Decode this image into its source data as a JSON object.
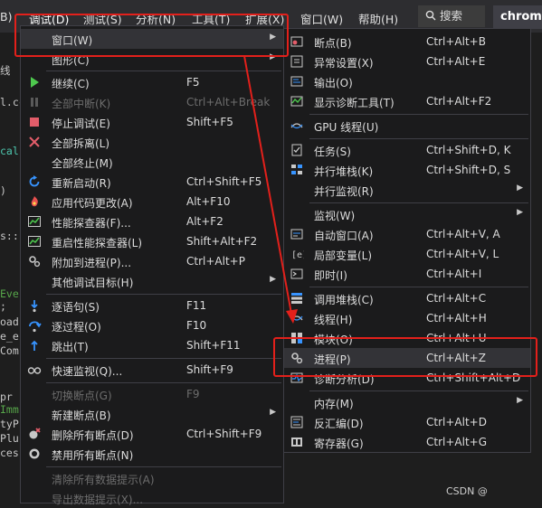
{
  "menubar": {
    "items": [
      "B)",
      "调试(D)",
      "测试(S)",
      "分析(N)",
      "工具(T)",
      "扩展(X)",
      "窗口(W)",
      "帮助(H)"
    ],
    "search_label": "搜索",
    "tab_label": "chrome"
  },
  "code_fragments": [
    "线",
    "l.cc",
    "cal",
    ")",
    "s::",
    "Eve",
    ";",
    "oad",
    "e_e",
    "Com",
    "pr",
    "Imm",
    "tyP",
    "Plu",
    "ces"
  ],
  "debug_menu": {
    "items": [
      {
        "label": "窗口(W)",
        "shortcut": "",
        "submenu": true,
        "icon": "none",
        "disabled": false
      },
      {
        "label": "图形(C)",
        "shortcut": "",
        "submenu": true,
        "icon": "none",
        "disabled": false
      },
      {
        "label": "继续(C)",
        "shortcut": "F5",
        "submenu": false,
        "icon": "play-icon",
        "disabled": false
      },
      {
        "label": "全部中断(K)",
        "shortcut": "Ctrl+Alt+Break",
        "submenu": false,
        "icon": "pause-icon",
        "disabled": true
      },
      {
        "label": "停止调试(E)",
        "shortcut": "Shift+F5",
        "submenu": false,
        "icon": "stop-icon",
        "disabled": false
      },
      {
        "label": "全部拆离(L)",
        "shortcut": "",
        "submenu": false,
        "icon": "detach-icon",
        "disabled": false
      },
      {
        "label": "全部终止(M)",
        "shortcut": "",
        "submenu": false,
        "icon": "none",
        "disabled": false
      },
      {
        "label": "重新启动(R)",
        "shortcut": "Ctrl+Shift+F5",
        "submenu": false,
        "icon": "restart-icon",
        "disabled": false
      },
      {
        "label": "应用代码更改(A)",
        "shortcut": "Alt+F10",
        "submenu": false,
        "icon": "hot-reload-icon",
        "disabled": false
      },
      {
        "label": "性能探查器(F)...",
        "shortcut": "Alt+F2",
        "submenu": false,
        "icon": "profiler-icon",
        "disabled": false
      },
      {
        "label": "重启性能探查器(L)",
        "shortcut": "Shift+Alt+F2",
        "submenu": false,
        "icon": "profiler-restart-icon",
        "disabled": false
      },
      {
        "label": "附加到进程(P)...",
        "shortcut": "Ctrl+Alt+P",
        "submenu": false,
        "icon": "attach-gear-icon",
        "disabled": false
      },
      {
        "label": "其他调试目标(H)",
        "shortcut": "",
        "submenu": true,
        "icon": "none",
        "disabled": false
      },
      {
        "label": "逐语句(S)",
        "shortcut": "F11",
        "submenu": false,
        "icon": "step-into-icon",
        "disabled": false
      },
      {
        "label": "逐过程(O)",
        "shortcut": "F10",
        "submenu": false,
        "icon": "step-over-icon",
        "disabled": false
      },
      {
        "label": "跳出(T)",
        "shortcut": "Shift+F11",
        "submenu": false,
        "icon": "step-out-icon",
        "disabled": false
      },
      {
        "label": "快速监视(Q)...",
        "shortcut": "Shift+F9",
        "submenu": false,
        "icon": "glasses-icon",
        "disabled": false
      },
      {
        "label": "切换断点(G)",
        "shortcut": "F9",
        "submenu": false,
        "icon": "none",
        "disabled": true
      },
      {
        "label": "新建断点(B)",
        "shortcut": "",
        "submenu": true,
        "icon": "none",
        "disabled": false
      },
      {
        "label": "删除所有断点(D)",
        "shortcut": "Ctrl+Shift+F9",
        "submenu": false,
        "icon": "delete-breakpoints-icon",
        "disabled": false
      },
      {
        "label": "禁用所有断点(N)",
        "shortcut": "",
        "submenu": false,
        "icon": "disable-breakpoints-icon",
        "disabled": false
      },
      {
        "label": "清除所有数据提示(A)",
        "shortcut": "",
        "submenu": false,
        "icon": "none",
        "disabled": true
      },
      {
        "label": "导出数据提示(X)...",
        "shortcut": "",
        "submenu": false,
        "icon": "none",
        "disabled": true
      }
    ]
  },
  "window_submenu": {
    "items": [
      {
        "label": "断点(B)",
        "shortcut": "Ctrl+Alt+B",
        "submenu": false,
        "icon": "breakpoints-window-icon"
      },
      {
        "label": "异常设置(X)",
        "shortcut": "Ctrl+Alt+E",
        "submenu": false,
        "icon": "exception-settings-icon"
      },
      {
        "label": "输出(O)",
        "shortcut": "",
        "submenu": false,
        "icon": "output-icon"
      },
      {
        "label": "显示诊断工具(T)",
        "shortcut": "Ctrl+Alt+F2",
        "submenu": false,
        "icon": "diagnostic-tools-icon"
      },
      {
        "label": "GPU 线程(U)",
        "shortcut": "",
        "submenu": false,
        "icon": "gpu-threads-icon"
      },
      {
        "label": "任务(S)",
        "shortcut": "Ctrl+Shift+D, K",
        "submenu": false,
        "icon": "tasks-icon"
      },
      {
        "label": "并行堆栈(K)",
        "shortcut": "Ctrl+Shift+D, S",
        "submenu": false,
        "icon": "parallel-stacks-icon"
      },
      {
        "label": "并行监视(R)",
        "shortcut": "",
        "submenu": true,
        "icon": "none"
      },
      {
        "label": "监视(W)",
        "shortcut": "",
        "submenu": true,
        "icon": "none"
      },
      {
        "label": "自动窗口(A)",
        "shortcut": "Ctrl+Alt+V, A",
        "submenu": false,
        "icon": "autos-icon"
      },
      {
        "label": "局部变量(L)",
        "shortcut": "Ctrl+Alt+V, L",
        "submenu": false,
        "icon": "locals-icon"
      },
      {
        "label": "即时(I)",
        "shortcut": "Ctrl+Alt+I",
        "submenu": false,
        "icon": "immediate-icon"
      },
      {
        "label": "调用堆栈(C)",
        "shortcut": "Ctrl+Alt+C",
        "submenu": false,
        "icon": "call-stack-icon"
      },
      {
        "label": "线程(H)",
        "shortcut": "Ctrl+Alt+H",
        "submenu": false,
        "icon": "threads-icon"
      },
      {
        "label": "模块(O)",
        "shortcut": "Ctrl+Alt+U",
        "submenu": false,
        "icon": "modules-icon"
      },
      {
        "label": "进程(P)",
        "shortcut": "Ctrl+Alt+Z",
        "submenu": false,
        "icon": "processes-gear-icon"
      },
      {
        "label": "诊断分析(D)",
        "shortcut": "Ctrl+Shift+Alt+D",
        "submenu": false,
        "icon": "diagnostics-analysis-icon"
      },
      {
        "label": "内存(M)",
        "shortcut": "",
        "submenu": true,
        "icon": "none"
      },
      {
        "label": "反汇编(D)",
        "shortcut": "Ctrl+Alt+D",
        "submenu": false,
        "icon": "disassembly-icon"
      },
      {
        "label": "寄存器(G)",
        "shortcut": "Ctrl+Alt+G",
        "submenu": false,
        "icon": "registers-icon"
      }
    ]
  },
  "watermark": "CSDN @"
}
